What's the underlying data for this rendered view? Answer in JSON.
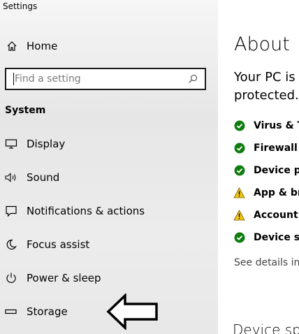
{
  "window": {
    "title": "Settings"
  },
  "sidebar": {
    "home_label": "Home",
    "search": {
      "placeholder": "Find a setting",
      "value": ""
    },
    "section_title": "System",
    "items": [
      {
        "label": "Display",
        "icon": "display-icon"
      },
      {
        "label": "Sound",
        "icon": "speaker-icon"
      },
      {
        "label": "Notifications & actions",
        "icon": "notification-icon"
      },
      {
        "label": "Focus assist",
        "icon": "moon-icon"
      },
      {
        "label": "Power & sleep",
        "icon": "power-icon"
      },
      {
        "label": "Storage",
        "icon": "storage-icon"
      }
    ]
  },
  "main": {
    "title": "About",
    "lead_line1": "Your PC is",
    "lead_line2": "protected.",
    "status_items": [
      {
        "label": "Virus & Th",
        "state": "ok"
      },
      {
        "label": "Firewall &",
        "state": "ok"
      },
      {
        "label": "Device pe",
        "state": "ok"
      },
      {
        "label": "App & bro",
        "state": "warning"
      },
      {
        "label": "Account p",
        "state": "warning"
      },
      {
        "label": "Device sec",
        "state": "ok"
      }
    ],
    "see_details": "See details in V",
    "device_specs": "Device spe"
  },
  "colors": {
    "ok": "#107c10",
    "warning": "#f2c811",
    "sidebar_bg": "#e9e9e9"
  }
}
